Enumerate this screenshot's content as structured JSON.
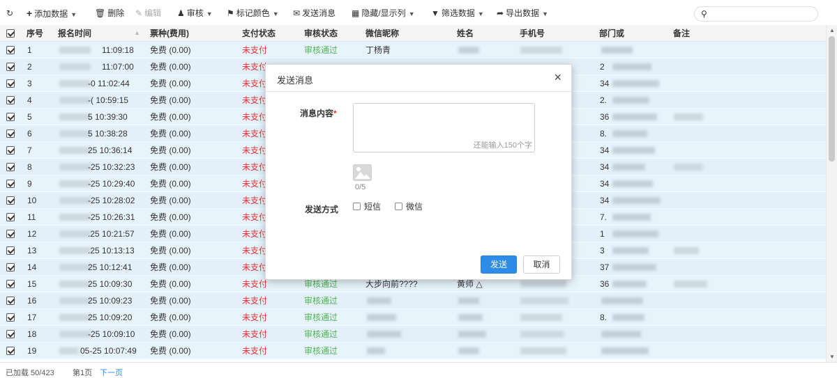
{
  "toolbar": {
    "add": "添加数据",
    "delete": "删除",
    "edit": "编辑",
    "review": "审核",
    "mark_color": "标记颜色",
    "send_message": "发送消息",
    "hide_show_columns": "隐藏/显示列",
    "filter": "筛选数据",
    "export": "导出数据",
    "search_value": ""
  },
  "table": {
    "headers": {
      "index": "序号",
      "signup_time": "报名时间",
      "ticket": "票种(费用)",
      "pay_status": "支付状态",
      "review_status": "审核状态",
      "wechat_nick": "微信昵称",
      "name": "姓名",
      "phone": "手机号",
      "dept": "部门或",
      "remark": "备注"
    },
    "rows": [
      {
        "idx": "1",
        "time": "11:09:18",
        "ticket": "免费 (0.00)",
        "pay": "未支付",
        "review": "审核通过",
        "nick": "丁杨青",
        "name": "",
        "dept": ""
      },
      {
        "idx": "2",
        "time": "11:07:00",
        "ticket": "免费 (0.00)",
        "pay": "未支付",
        "review": "",
        "nick": "",
        "name": "",
        "dept": "2"
      },
      {
        "idx": "3",
        "time": "-0 11:02:44",
        "ticket": "免费 (0.00)",
        "pay": "未支付",
        "review": "",
        "nick": "",
        "name": "",
        "dept": "34"
      },
      {
        "idx": "4",
        "time": "-( 10:59:15",
        "ticket": "免费 (0.00)",
        "pay": "未支付",
        "review": "",
        "nick": "",
        "name": "",
        "dept": "2."
      },
      {
        "idx": "5",
        "time": "5 10:39:30",
        "ticket": "免费 (0.00)",
        "pay": "未支付",
        "review": "",
        "nick": "",
        "name": "",
        "dept": "36"
      },
      {
        "idx": "6",
        "time": "5 10:38:28",
        "ticket": "免费 (0.00)",
        "pay": "未支付",
        "review": "",
        "nick": "",
        "name": "",
        "dept": "8."
      },
      {
        "idx": "7",
        "time": "25 10:36:14",
        "ticket": "免费 (0.00)",
        "pay": "未支付",
        "review": "",
        "nick": "",
        "name": "",
        "dept": "34"
      },
      {
        "idx": "8",
        "time": "-25 10:32:23",
        "ticket": "免费 (0.00)",
        "pay": "未支付",
        "review": "",
        "nick": "",
        "name": "",
        "dept": "34"
      },
      {
        "idx": "9",
        "time": "-25 10:29:40",
        "ticket": "免费 (0.00)",
        "pay": "未支付",
        "review": "",
        "nick": "",
        "name": "",
        "dept": "34"
      },
      {
        "idx": "10",
        "time": "-25 10:28:02",
        "ticket": "免费 (0.00)",
        "pay": "未支付",
        "review": "",
        "nick": "",
        "name": "",
        "dept": "34"
      },
      {
        "idx": "11",
        "time": "-25 10:26:31",
        "ticket": "免费 (0.00)",
        "pay": "未支付",
        "review": "",
        "nick": "",
        "name": "",
        "dept": "7."
      },
      {
        "idx": "12",
        "time": ".25 10:21:57",
        "ticket": "免费 (0.00)",
        "pay": "未支付",
        "review": "",
        "nick": "",
        "name": "",
        "dept": "1"
      },
      {
        "idx": "13",
        "time": ".25 10:13:13",
        "ticket": "免费 (0.00)",
        "pay": "未支付",
        "review": "",
        "nick": "",
        "name": "",
        "dept": "3"
      },
      {
        "idx": "14",
        "time": "25 10:12:41",
        "ticket": "免费 (0.00)",
        "pay": "未支付",
        "review": "",
        "nick": "",
        "name": "",
        "dept": "37"
      },
      {
        "idx": "15",
        "time": "25 10:09:30",
        "ticket": "免费 (0.00)",
        "pay": "未支付",
        "review": "审核通过",
        "nick": "大步向前????",
        "name": "黄师 △",
        "dept": "36"
      },
      {
        "idx": "16",
        "time": "25 10:09:23",
        "ticket": "免费 (0.00)",
        "pay": "未支付",
        "review": "审核通过",
        "nick": "",
        "name": "",
        "dept": ""
      },
      {
        "idx": "17",
        "time": "25 10:09:20",
        "ticket": "免费 (0.00)",
        "pay": "未支付",
        "review": "审核通过",
        "nick": "",
        "name": "",
        "dept": "8."
      },
      {
        "idx": "18",
        "time": "-25 10:09:10",
        "ticket": "免费 (0.00)",
        "pay": "未支付",
        "review": "审核通过",
        "nick": "",
        "name": "",
        "dept": ""
      },
      {
        "idx": "19",
        "time": "05-25 10:07:49",
        "ticket": "免费 (0.00)",
        "pay": "未支付",
        "review": "审核通过",
        "nick": "",
        "name": "",
        "dept": ""
      }
    ]
  },
  "dialog": {
    "title": "发送消息",
    "content_label": "消息内容",
    "required_mark": "*",
    "textarea_value": "",
    "char_counter": "还能输入150个字",
    "image_count": "0/5",
    "method_label": "发送方式",
    "option_sms": "短信",
    "option_wechat": "微信",
    "send_button": "发送",
    "cancel_button": "取消"
  },
  "footer": {
    "loaded": "已加载 50/423",
    "page": "第1页",
    "next": "下一页"
  },
  "colors": {
    "unpaid": "#e03131",
    "approved": "#52b552",
    "primary": "#2d8ce8",
    "row_bg": "#e8f4fc"
  }
}
